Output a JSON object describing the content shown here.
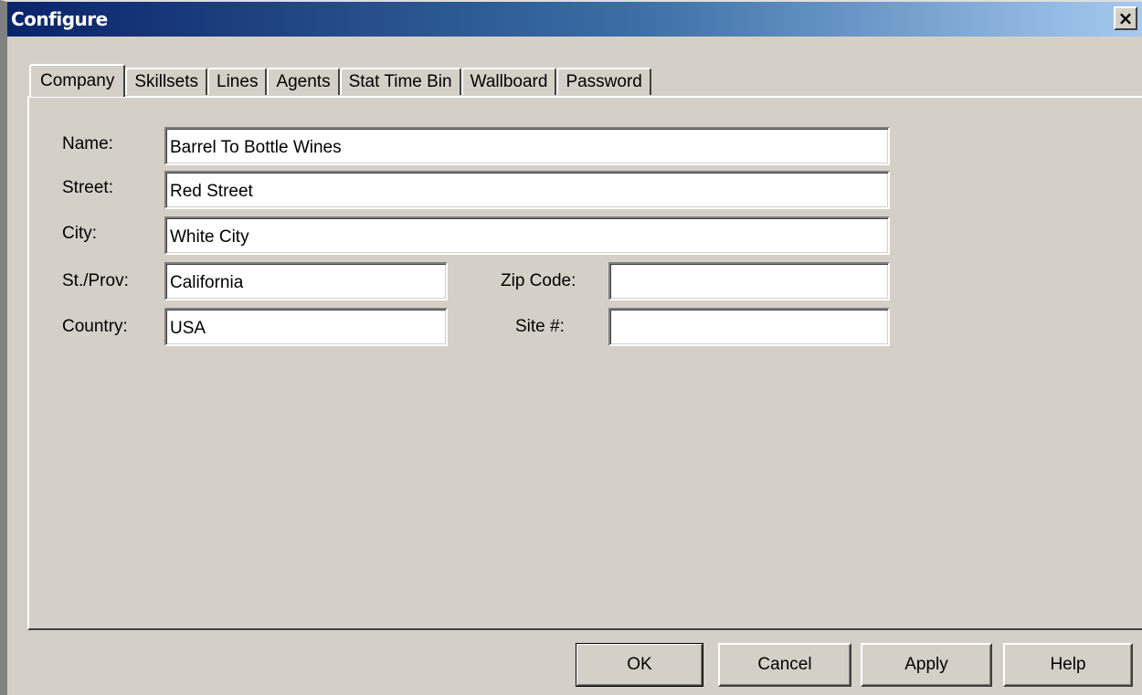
{
  "window": {
    "title": "Configure",
    "close_glyph": "×"
  },
  "tabs": [
    {
      "label": "Company",
      "active": true
    },
    {
      "label": "Skillsets",
      "active": false
    },
    {
      "label": "Lines",
      "active": false
    },
    {
      "label": "Agents",
      "active": false
    },
    {
      "label": "Stat Time Bin",
      "active": false
    },
    {
      "label": "Wallboard",
      "active": false
    },
    {
      "label": "Password",
      "active": false
    }
  ],
  "company": {
    "name_label": "Name:",
    "name_value": "Barrel To Bottle Wines",
    "street_label": "Street:",
    "street_value": "Red Street",
    "city_label": "City:",
    "city_value": "White City",
    "state_label": "St./Prov:",
    "state_value": "California",
    "zip_label": "Zip Code:",
    "zip_value": "",
    "country_label": "Country:",
    "country_value": "USA",
    "site_label": "Site #:",
    "site_value": ""
  },
  "buttons": {
    "ok": "OK",
    "cancel": "Cancel",
    "apply": "Apply",
    "help": "Help"
  },
  "colors": {
    "titlebar_start": "#0a246a",
    "titlebar_end": "#a6caf0",
    "face": "#d4d0c8"
  }
}
